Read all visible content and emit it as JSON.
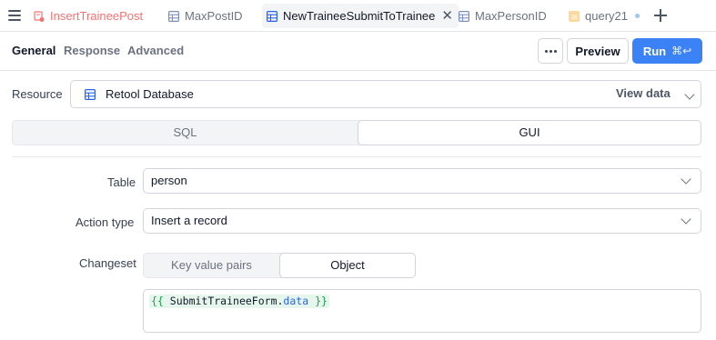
{
  "tabs": [
    {
      "label": "InsertTraineePost",
      "icon": "query-error-icon",
      "state": "error"
    },
    {
      "label": "MaxPostID",
      "icon": "table-icon",
      "state": "normal"
    },
    {
      "label": "NewTraineeSubmitToTrainee",
      "icon": "table-icon",
      "state": "active"
    },
    {
      "label": "MaxPersonID",
      "icon": "table-icon",
      "state": "normal"
    },
    {
      "label": "query21",
      "icon": "js-icon",
      "state": "unsaved"
    }
  ],
  "subtabs": {
    "general": "General",
    "response": "Response",
    "advanced": "Advanced"
  },
  "toolbar": {
    "preview_label": "Preview",
    "run_label": "Run",
    "run_shortcut": "⌘↩",
    "run_color": "#3b82f6"
  },
  "resource": {
    "label": "Resource",
    "value": "Retool Database",
    "view_data": "View data"
  },
  "mode": {
    "options": [
      "SQL",
      "GUI"
    ],
    "selected": "GUI"
  },
  "table": {
    "label": "Table",
    "value": "person"
  },
  "action_type": {
    "label": "Action type",
    "value": "Insert a record"
  },
  "changeset": {
    "label": "Changeset",
    "options": [
      "Key value pairs",
      "Object"
    ],
    "selected": "Object",
    "code_open": "{{",
    "code_ident": "SubmitTraineeForm.",
    "code_prop": "data",
    "code_close": "}}"
  }
}
